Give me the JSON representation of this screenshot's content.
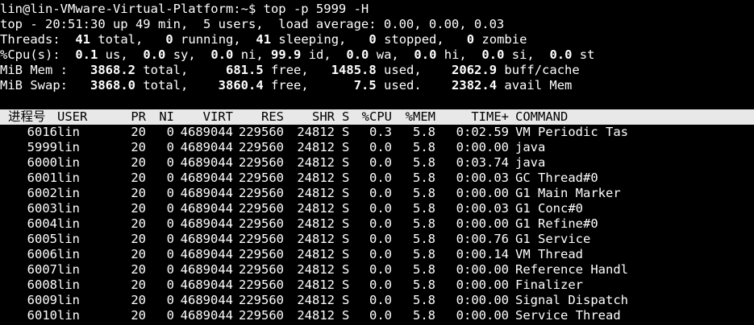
{
  "prompt": "lin@lin-VMware-Virtual-Platform:~$ top -p 5999 -H",
  "summary": {
    "uptime_line": "top - 20:51:30 up 49 min,  5 users,  load average: 0.00, 0.00, 0.03",
    "threads": {
      "label": "Threads:",
      "total": "41",
      "total_label": "total,",
      "running": "0",
      "running_label": "running,",
      "sleeping": "41",
      "sleeping_label": "sleeping,",
      "stopped": "0",
      "stopped_label": "stopped,",
      "zombie": "0",
      "zombie_label": "zombie"
    },
    "cpu": {
      "label": "%Cpu(s):",
      "us": "0.1",
      "us_label": "us,",
      "sy": "0.0",
      "sy_label": "sy,",
      "ni": "0.0",
      "ni_label": "ni,",
      "id": "99.9",
      "id_label": "id,",
      "wa": "0.0",
      "wa_label": "wa,",
      "hi": "0.0",
      "hi_label": "hi,",
      "si": "0.0",
      "si_label": "si,",
      "st": "0.0",
      "st_label": "st"
    },
    "mem": {
      "label": "MiB Mem :",
      "total": "3868.2",
      "total_label": "total,",
      "free": "681.5",
      "free_label": "free,",
      "used": "1485.8",
      "used_label": "used,",
      "buff": "2062.9",
      "buff_label": "buff/cache"
    },
    "swap": {
      "label": "MiB Swap:",
      "total": "3868.0",
      "total_label": "total,",
      "free": "3860.4",
      "free_label": "free,",
      "used": "7.5",
      "used_label": "used.",
      "avail": "2382.4",
      "avail_label": "avail Mem"
    }
  },
  "table": {
    "headers": {
      "pid": "进程号",
      "user": "USER",
      "pr": "PR",
      "ni": "NI",
      "virt": "VIRT",
      "res": "RES",
      "shr": "SHR",
      "s": "S",
      "cpu": "%CPU",
      "mem": "%MEM",
      "time": "TIME+",
      "command": "COMMAND"
    },
    "rows": [
      {
        "pid": "6016",
        "user": "lin",
        "pr": "20",
        "ni": "0",
        "virt": "4689044",
        "res": "229560",
        "shr": "24812",
        "s": "S",
        "cpu": "0.3",
        "mem": "5.8",
        "time": "0:02.59",
        "command": "VM Periodic Tas"
      },
      {
        "pid": "5999",
        "user": "lin",
        "pr": "20",
        "ni": "0",
        "virt": "4689044",
        "res": "229560",
        "shr": "24812",
        "s": "S",
        "cpu": "0.0",
        "mem": "5.8",
        "time": "0:00.00",
        "command": "java"
      },
      {
        "pid": "6000",
        "user": "lin",
        "pr": "20",
        "ni": "0",
        "virt": "4689044",
        "res": "229560",
        "shr": "24812",
        "s": "S",
        "cpu": "0.0",
        "mem": "5.8",
        "time": "0:03.74",
        "command": "java"
      },
      {
        "pid": "6001",
        "user": "lin",
        "pr": "20",
        "ni": "0",
        "virt": "4689044",
        "res": "229560",
        "shr": "24812",
        "s": "S",
        "cpu": "0.0",
        "mem": "5.8",
        "time": "0:00.03",
        "command": "GC Thread#0"
      },
      {
        "pid": "6002",
        "user": "lin",
        "pr": "20",
        "ni": "0",
        "virt": "4689044",
        "res": "229560",
        "shr": "24812",
        "s": "S",
        "cpu": "0.0",
        "mem": "5.8",
        "time": "0:00.00",
        "command": "G1 Main Marker"
      },
      {
        "pid": "6003",
        "user": "lin",
        "pr": "20",
        "ni": "0",
        "virt": "4689044",
        "res": "229560",
        "shr": "24812",
        "s": "S",
        "cpu": "0.0",
        "mem": "5.8",
        "time": "0:00.03",
        "command": "G1 Conc#0"
      },
      {
        "pid": "6004",
        "user": "lin",
        "pr": "20",
        "ni": "0",
        "virt": "4689044",
        "res": "229560",
        "shr": "24812",
        "s": "S",
        "cpu": "0.0",
        "mem": "5.8",
        "time": "0:00.00",
        "command": "G1 Refine#0"
      },
      {
        "pid": "6005",
        "user": "lin",
        "pr": "20",
        "ni": "0",
        "virt": "4689044",
        "res": "229560",
        "shr": "24812",
        "s": "S",
        "cpu": "0.0",
        "mem": "5.8",
        "time": "0:00.76",
        "command": "G1 Service"
      },
      {
        "pid": "6006",
        "user": "lin",
        "pr": "20",
        "ni": "0",
        "virt": "4689044",
        "res": "229560",
        "shr": "24812",
        "s": "S",
        "cpu": "0.0",
        "mem": "5.8",
        "time": "0:00.14",
        "command": "VM Thread"
      },
      {
        "pid": "6007",
        "user": "lin",
        "pr": "20",
        "ni": "0",
        "virt": "4689044",
        "res": "229560",
        "shr": "24812",
        "s": "S",
        "cpu": "0.0",
        "mem": "5.8",
        "time": "0:00.00",
        "command": "Reference Handl"
      },
      {
        "pid": "6008",
        "user": "lin",
        "pr": "20",
        "ni": "0",
        "virt": "4689044",
        "res": "229560",
        "shr": "24812",
        "s": "S",
        "cpu": "0.0",
        "mem": "5.8",
        "time": "0:00.00",
        "command": "Finalizer"
      },
      {
        "pid": "6009",
        "user": "lin",
        "pr": "20",
        "ni": "0",
        "virt": "4689044",
        "res": "229560",
        "shr": "24812",
        "s": "S",
        "cpu": "0.0",
        "mem": "5.8",
        "time": "0:00.00",
        "command": "Signal Dispatch"
      },
      {
        "pid": "6010",
        "user": "lin",
        "pr": "20",
        "ni": "0",
        "virt": "4689044",
        "res": "229560",
        "shr": "24812",
        "s": "S",
        "cpu": "0.0",
        "mem": "5.8",
        "time": "0:00.00",
        "command": "Service Thread"
      }
    ]
  },
  "colors": {
    "background": "#000000",
    "foreground": "#ffffff",
    "header_background": "#e8e8e8",
    "header_foreground": "#000000"
  }
}
